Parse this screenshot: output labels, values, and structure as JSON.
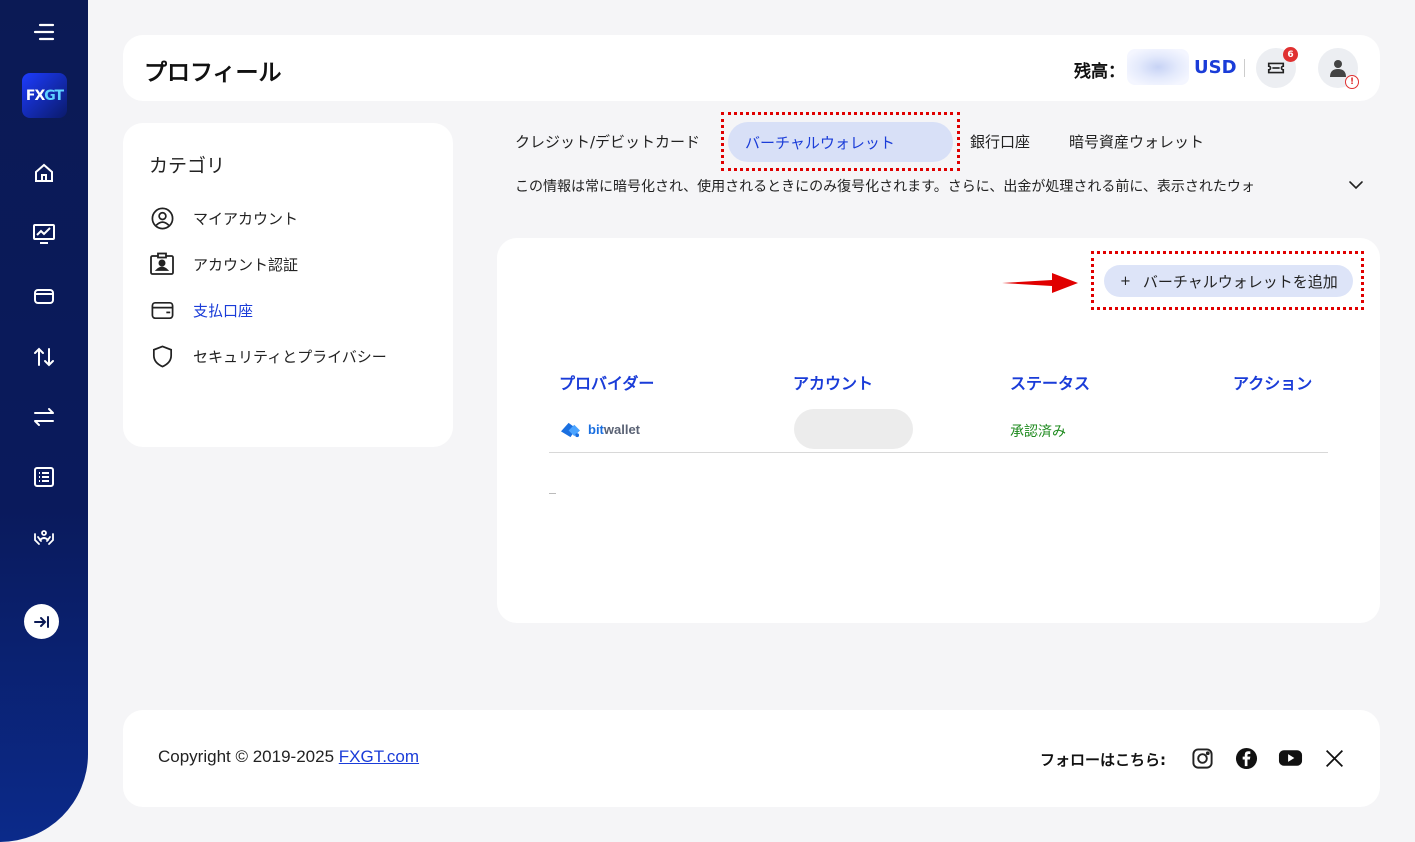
{
  "header": {
    "title": "プロフィール",
    "balance_label": "残高：",
    "currency": "USD",
    "notification_count": "6",
    "alert_mark": "!"
  },
  "sidebar": {
    "logo_fx": "FX",
    "logo_gt": "GT",
    "items": [
      {
        "icon": "menu-icon"
      },
      {
        "icon": "home-icon"
      },
      {
        "icon": "chart-icon"
      },
      {
        "icon": "wallet-icon"
      },
      {
        "icon": "transfer-vertical-icon"
      },
      {
        "icon": "exchange-icon"
      },
      {
        "icon": "list-icon"
      },
      {
        "icon": "partner-icon"
      },
      {
        "icon": "expand-icon"
      }
    ]
  },
  "category": {
    "title": "カテゴリ",
    "items": [
      {
        "label": "マイアカウント",
        "icon": "user-circle-icon"
      },
      {
        "label": "アカウント認証",
        "icon": "id-card-icon"
      },
      {
        "label": "支払口座",
        "icon": "wallet-icon",
        "active": true
      },
      {
        "label": "セキュリティとプライバシー",
        "icon": "shield-icon"
      }
    ]
  },
  "tabs": {
    "items": [
      "クレジット/デビットカード",
      "バーチャルウォレット",
      "銀行口座",
      "暗号資産ウォレット"
    ],
    "active": "バーチャルウォレット"
  },
  "info_text": "この情報は常に暗号化され、使用されるときにのみ復号化されます。さらに、出金が処理される前に、表示されたウォ",
  "main": {
    "add_button": "バーチャルウォレットを追加",
    "add_plus": "+",
    "table": {
      "headers": [
        "プロバイダー",
        "アカウント",
        "ステータス",
        "アクション"
      ],
      "rows": [
        {
          "provider_bit": "bit",
          "provider_wallet": "wallet",
          "status": "承認済み"
        }
      ]
    }
  },
  "footer": {
    "copyright": "Copyright © 2019-2025 ",
    "link": "FXGT.com",
    "follow": "フォローはこちら:",
    "social": [
      "instagram-icon",
      "facebook-icon",
      "youtube-icon",
      "x-icon"
    ]
  },
  "colors": {
    "accent": "#1a3cd8",
    "sidebar": "#0b1a55",
    "status_ok": "#1e8a1e",
    "highlight": "#e00000"
  }
}
